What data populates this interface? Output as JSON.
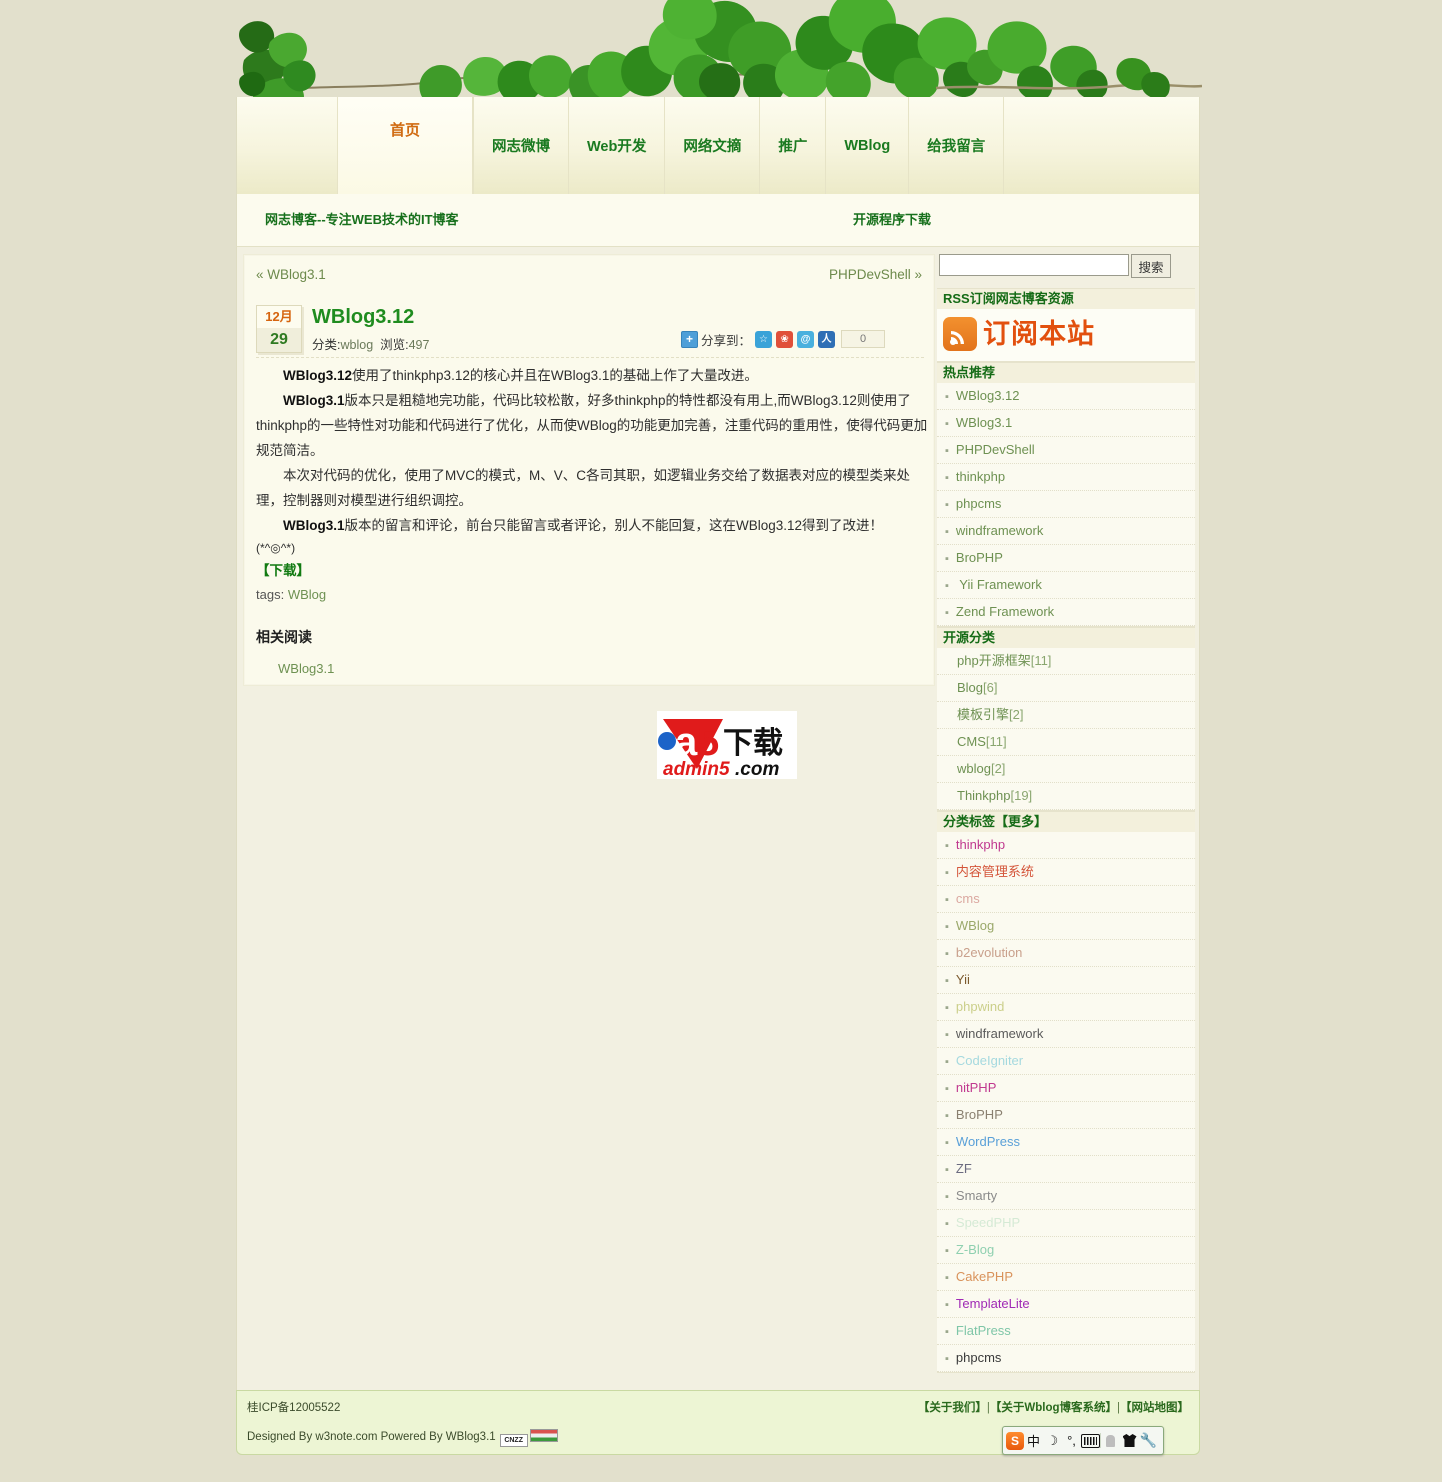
{
  "site": {
    "nav": [
      {
        "label": "首页",
        "active": true
      },
      {
        "label": "网志微博",
        "active": false
      },
      {
        "label": "Web开发",
        "active": false
      },
      {
        "label": "网络文摘",
        "active": false
      },
      {
        "label": "推广",
        "active": false
      },
      {
        "label": "WBlog",
        "active": false
      },
      {
        "label": "给我留言",
        "active": false
      }
    ],
    "subheader": {
      "left": "网志博客--专注WEB技术的IT博客",
      "right": "开源程序下载"
    }
  },
  "post": {
    "prev": "« WBlog3.1",
    "next": "PHPDevShell »",
    "date_month": "12月",
    "date_day": "29",
    "title": "WBlog3.12",
    "meta_category_label": "分类:",
    "meta_category_value": "wblog",
    "meta_views_label": "浏览:",
    "meta_views_value": "497",
    "share_label": "分享到：",
    "share_count": "0",
    "share_icons": [
      "qzone-icon",
      "sina-weibo-icon",
      "tencent-weibo-icon",
      "renren-icon"
    ],
    "paragraphs": [
      {
        "lead": "WBlog3.12",
        "rest": "使用了thinkphp3.12的核心并且在WBlog3.1的基础上作了大量改进。"
      },
      {
        "lead": "WBlog3.1",
        "rest": "版本只是粗糙地完功能，代码比较松散，好多thinkphp的特性都没有用上,而WBlog3.12则使用了thinkphp的一些特性对功能和代码进行了优化，从而使WBlog的功能更加完善，注重代码的重用性，使得代码更加规范简洁。"
      },
      {
        "lead": "",
        "rest": "本次对代码的优化，使用了MVC的模式，M、V、C各司其职，如逻辑业务交给了数据表对应的模型类来处理，控制器则对模型进行组织调控。"
      },
      {
        "lead": "WBlog3.1",
        "rest": "版本的留言和评论，前台只能留言或者评论，别人不能回复，这在WBlog3.12得到了改进！"
      }
    ],
    "emoticon": "(*^◎^*)",
    "download_link": "【下载】",
    "tags_label": "tags:",
    "tags": [
      "WBlog"
    ],
    "related_heading": "相关阅读",
    "related": [
      "WBlog3.1"
    ],
    "watermark": {
      "big": "a5下载",
      "small": "admin5.com"
    }
  },
  "sidebar": {
    "search": {
      "value": "",
      "placeholder": "",
      "button": "搜索"
    },
    "rss": {
      "heading": "RSS订阅网志博客资源",
      "link_text": "订阅本站"
    },
    "hot": {
      "heading": "热点推荐",
      "items": [
        "WBlog3.12",
        "WBlog3.1",
        "PHPDevShell",
        "thinkphp",
        "phpcms",
        "windframework",
        "BroPHP",
        " Yii Framework",
        "Zend Framework"
      ]
    },
    "categories": {
      "heading": "开源分类",
      "items": [
        {
          "name": "php开源框架",
          "count": "[11]"
        },
        {
          "name": "Blog",
          "count": "[6]"
        },
        {
          "name": "模板引擎",
          "count": "[2]"
        },
        {
          "name": "CMS",
          "count": "[11]"
        },
        {
          "name": "wblog",
          "count": "[2]"
        },
        {
          "name": "Thinkphp",
          "count": "[19]"
        }
      ]
    },
    "tags": {
      "heading": "分类标签【更多】",
      "items": [
        {
          "label": "thinkphp",
          "color": "#c0398f"
        },
        {
          "label": "内容管理系统",
          "color": "#d4553a"
        },
        {
          "label": "cms",
          "color": "#dba8a0"
        },
        {
          "label": "WBlog",
          "color": "#9aa86a"
        },
        {
          "label": "b2evolution",
          "color": "#c9a08c"
        },
        {
          "label": "Yii",
          "color": "#7c5a2e"
        },
        {
          "label": "phpwind",
          "color": "#cbcf8a"
        },
        {
          "label": "windframework",
          "color": "#5a5a5a"
        },
        {
          "label": "CodeIgniter",
          "color": "#a5d9df"
        },
        {
          "label": "nitPHP",
          "color": "#c0398f"
        },
        {
          "label": "BroPHP",
          "color": "#8a8070"
        },
        {
          "label": "WordPress",
          "color": "#5aa0d8"
        },
        {
          "label": "ZF",
          "color": "#6b6b80"
        },
        {
          "label": "Smarty",
          "color": "#8a8a8a"
        },
        {
          "label": "SpeedPHP",
          "color": "#d5ead5"
        },
        {
          "label": "Z-Blog",
          "color": "#8fd0b0"
        },
        {
          "label": "CakePHP",
          "color": "#d9925a"
        },
        {
          "label": "TemplateLite",
          "color": "#a02ab5"
        },
        {
          "label": "FlatPress",
          "color": "#7fc6a8"
        },
        {
          "label": "phpcms",
          "color": "#3a3a3a"
        }
      ]
    }
  },
  "footer": {
    "icp": "桂ICP备12005522",
    "links": [
      "【关于我们】",
      "【关于Wblog博客系统】",
      "【网站地图】"
    ],
    "separator": "|",
    "designed_by": "Designed By w3note.com Powered By WBlog3.1",
    "cnzz_label": "CNZZ"
  },
  "ime": {
    "logo": "S",
    "mode": "中",
    "moon": "☽",
    "degree": "°,",
    "keyboard": "keyboard-icon",
    "person": "person-icon",
    "skin": "shirt-icon",
    "tools": "🔧"
  }
}
